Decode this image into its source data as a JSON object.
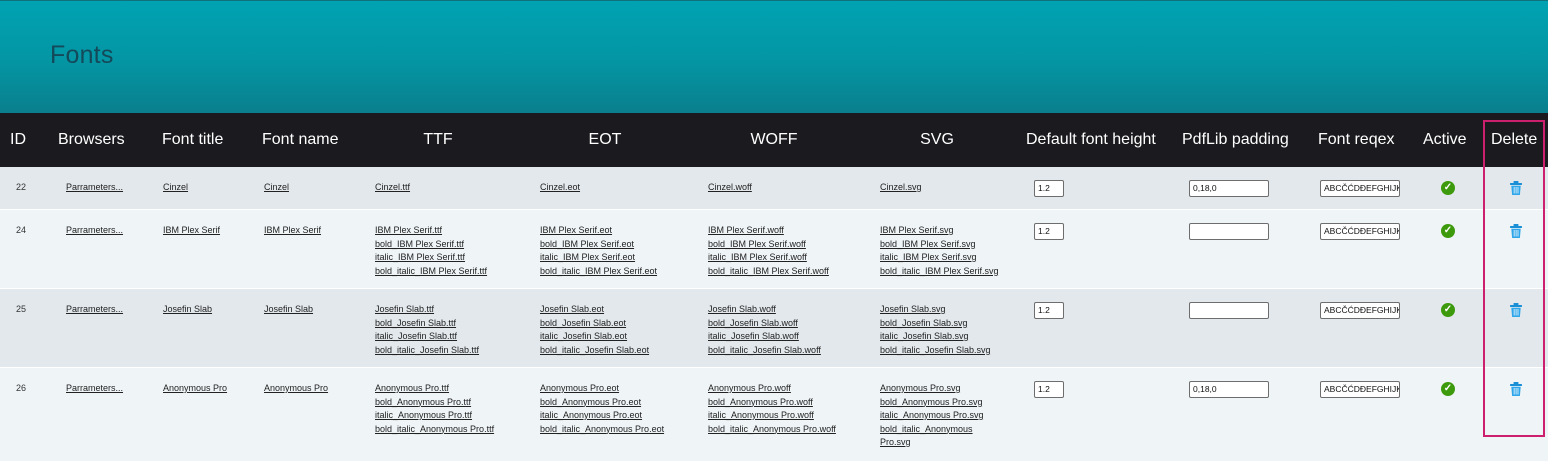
{
  "page": {
    "title": "Fonts"
  },
  "table": {
    "headers": {
      "id": "ID",
      "browsers": "Browsers",
      "font_title": "Font title",
      "font_name": "Font name",
      "ttf": "TTF",
      "eot": "EOT",
      "woff": "WOFF",
      "svg": "SVG",
      "default_font_height": "Default font height",
      "pdflib_padding": "PdfLib padding",
      "font_regex": "Font reqex",
      "active": "Active",
      "delete": "Delete"
    },
    "rows": [
      {
        "id": "22",
        "browsers": "Parrameters...",
        "font_title": "Cinzel",
        "font_name": "Cinzel",
        "ttf": [
          "Cinzel.ttf"
        ],
        "eot": [
          "Cinzel.eot"
        ],
        "woff": [
          "Cinzel.woff"
        ],
        "svg": [
          "Cinzel.svg"
        ],
        "default_font_height": "1.2",
        "pdflib_padding": "0,18,0",
        "font_regex": "ABCČĆDĐEFGHIJKL",
        "active": true
      },
      {
        "id": "24",
        "browsers": "Parrameters...",
        "font_title": "IBM Plex Serif",
        "font_name": "IBM Plex Serif",
        "ttf": [
          "IBM Plex Serif.ttf",
          "bold_IBM Plex Serif.ttf",
          "italic_IBM Plex Serif.ttf",
          "bold_italic_IBM Plex Serif.ttf"
        ],
        "eot": [
          "IBM Plex Serif.eot",
          "bold_IBM Plex Serif.eot",
          "italic_IBM Plex Serif.eot",
          "bold_italic_IBM Plex Serif.eot"
        ],
        "woff": [
          "IBM Plex Serif.woff",
          "bold_IBM Plex Serif.woff",
          "italic_IBM Plex Serif.woff",
          "bold_italic_IBM Plex Serif.woff"
        ],
        "svg": [
          "IBM Plex Serif.svg",
          "bold_IBM Plex Serif.svg",
          "italic_IBM Plex Serif.svg",
          "bold_italic_IBM Plex Serif.svg"
        ],
        "default_font_height": "1.2",
        "pdflib_padding": "",
        "font_regex": "ABCČĆDĐEFGHIJKL",
        "active": true
      },
      {
        "id": "25",
        "browsers": "Parrameters...",
        "font_title": "Josefin Slab",
        "font_name": "Josefin Slab",
        "ttf": [
          "Josefin Slab.ttf",
          "bold_Josefin Slab.ttf",
          "italic_Josefin Slab.ttf",
          "bold_italic_Josefin Slab.ttf"
        ],
        "eot": [
          "Josefin Slab.eot",
          "bold_Josefin Slab.eot",
          "italic_Josefin Slab.eot",
          "bold_italic_Josefin Slab.eot"
        ],
        "woff": [
          "Josefin Slab.woff",
          "bold_Josefin Slab.woff",
          "italic_Josefin Slab.woff",
          "bold_italic_Josefin Slab.woff"
        ],
        "svg": [
          "Josefin Slab.svg",
          "bold_Josefin Slab.svg",
          "italic_Josefin Slab.svg",
          "bold_italic_Josefin Slab.svg"
        ],
        "default_font_height": "1.2",
        "pdflib_padding": "",
        "font_regex": "ABCČĆDĐEFGHIJKL",
        "active": true
      },
      {
        "id": "26",
        "browsers": "Parrameters...",
        "font_title": "Anonymous Pro",
        "font_name": "Anonymous Pro",
        "ttf": [
          "Anonymous Pro.ttf",
          "bold_Anonymous Pro.ttf",
          "italic_Anonymous Pro.ttf",
          "bold_italic_Anonymous Pro.ttf"
        ],
        "eot": [
          "Anonymous Pro.eot",
          "bold_Anonymous Pro.eot",
          "italic_Anonymous Pro.eot",
          "bold_italic_Anonymous Pro.eot"
        ],
        "woff": [
          "Anonymous Pro.woff",
          "bold_Anonymous Pro.woff",
          "italic_Anonymous Pro.woff",
          "bold_italic_Anonymous Pro.woff"
        ],
        "svg": [
          "Anonymous Pro.svg",
          "bold_Anonymous Pro.svg",
          "italic_Anonymous Pro.svg",
          "bold_italic_Anonymous Pro.svg"
        ],
        "default_font_height": "1.2",
        "pdflib_padding": "0,18,0",
        "font_regex": "ABCČĆDĐEFGHIJKL",
        "active": true
      }
    ]
  },
  "icons": {
    "active": "check-circle-icon",
    "delete": "trash-icon"
  },
  "colors": {
    "header_gradient_top": "#00a3b3",
    "header_gradient_bottom": "#0a7f8d",
    "table_head_bg": "#1b1a1f",
    "active_green": "#3d9a0d",
    "trash_blue": "#1a8fd6",
    "highlight_border": "#cc1f6d"
  }
}
